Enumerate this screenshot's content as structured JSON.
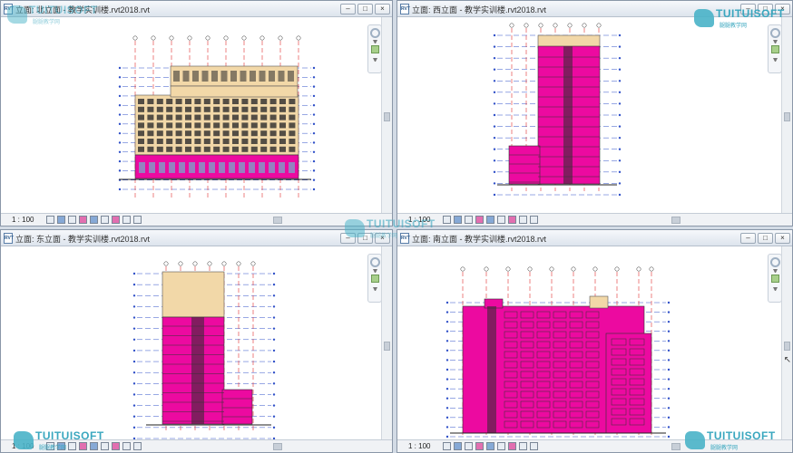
{
  "views": [
    {
      "title": "立面: 北立面 - 教学实训楼.rvt2018.rvt",
      "scale": "1 : 100",
      "buttons": [
        "–",
        "□",
        "×"
      ]
    },
    {
      "title": "立面: 西立面 - 教学实训楼.rvt2018.rvt",
      "scale": "1 : 100",
      "buttons": [
        "–",
        "□",
        "×"
      ]
    },
    {
      "title": "立面: 东立面 - 教学实训楼.rvt2018.rvt",
      "scale": "1 : 100",
      "buttons": [
        "–",
        "□",
        "×"
      ]
    },
    {
      "title": "立面: 南立面 - 教学实训楼.rvt2018.rvt",
      "scale": "1 : 100",
      "buttons": [
        "–",
        "□",
        "×"
      ]
    }
  ],
  "watermark": {
    "brand": "TUITUISOFT",
    "subtitle": "腿腿教学网"
  },
  "colors": {
    "magenta": "#ec0aa0",
    "tan": "#f2d8a8",
    "grid_line": "#e03030",
    "level_line": "#3050c8",
    "window_dark": "#2c2c2c"
  },
  "icons": {
    "statusbar": [
      "model-graphics-icon",
      "sun-path-icon",
      "shadows-icon",
      "crop-view-icon",
      "show-crop-icon",
      "temporary-hide-icon",
      "reveal-hidden-icon",
      "worksharing-icon",
      "design-options-icon"
    ],
    "navbar": [
      "steering-wheel-icon",
      "zoom-icon"
    ]
  }
}
